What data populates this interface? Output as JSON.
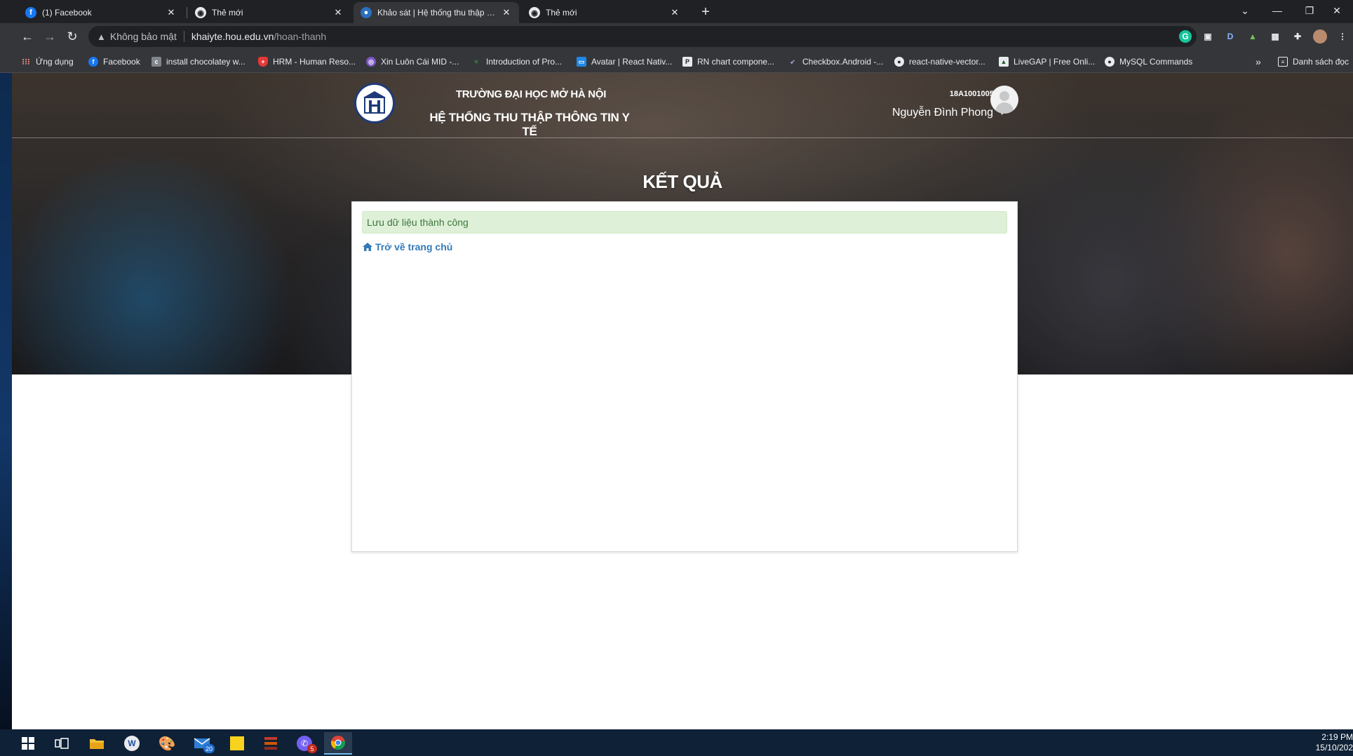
{
  "browser": {
    "tabs": [
      {
        "title": "(1) Facebook",
        "icon": "facebook-icon"
      },
      {
        "title": "Thẻ mới",
        "icon": "chrome-icon"
      },
      {
        "title": "Khảo sát | Hệ thống thu thập thô",
        "icon": "globe-icon",
        "active": true
      },
      {
        "title": "Thẻ mới",
        "icon": "chrome-icon"
      }
    ],
    "omnibox": {
      "security_text": "Không bảo mật",
      "host": "khaiyte.hou.edu.vn",
      "path": "/hoan-thanh"
    },
    "bookmarks": [
      {
        "label": "Ứng dụng",
        "icon": "apps-grid-icon"
      },
      {
        "label": "Facebook",
        "icon": "facebook-icon"
      },
      {
        "label": "install chocolatey w...",
        "icon": "chocolatey-icon"
      },
      {
        "label": "HRM - Human Reso...",
        "icon": "shield-icon"
      },
      {
        "label": "Xin Luôn Cái MID -...",
        "icon": "purple-globe-icon"
      },
      {
        "label": "Introduction of Pro...",
        "icon": "green-dash-icon"
      },
      {
        "label": "Avatar | React Nativ...",
        "icon": "react-native-icon"
      },
      {
        "label": "RN chart compone...",
        "icon": "p-square-icon"
      },
      {
        "label": "Checkbox.Android -...",
        "icon": "rocket-icon"
      },
      {
        "label": "react-native-vector...",
        "icon": "github-icon"
      },
      {
        "label": "LiveGAP | Free Onli...",
        "icon": "livegap-icon"
      },
      {
        "label": "MySQL Commands",
        "icon": "github-icon"
      }
    ],
    "bookmarks_overflow": "»",
    "reading_list": "Danh sách đọc"
  },
  "page": {
    "university": "TRƯỜNG ĐẠI HỌC MỞ HÀ NỘI",
    "system": "HỆ THỐNG THU THẬP THÔNG TIN Y TẾ",
    "student_id": "18A10010057",
    "user_name": "Nguyễn Đình Phong",
    "title": "KẾT QUẢ",
    "alert": "Lưu dữ liệu thành công",
    "home_link": "Trở về trang chủ"
  },
  "taskbar": {
    "apps": [
      {
        "name": "start-button"
      },
      {
        "name": "task-view"
      },
      {
        "name": "file-explorer"
      },
      {
        "name": "app-w"
      },
      {
        "name": "paint-app"
      },
      {
        "name": "mail-app",
        "badge": "20"
      },
      {
        "name": "sticky-notes"
      },
      {
        "name": "terminal-app"
      },
      {
        "name": "viber-app",
        "badge": "5"
      },
      {
        "name": "chrome-app",
        "active": true
      }
    ],
    "time": "2:19 PM",
    "date": "15/10/202"
  },
  "colors": {
    "chrome_dark": "#202124",
    "chrome_toolbar": "#35363a",
    "alert_bg": "#dff0d8",
    "alert_text": "#3c763d",
    "link": "#337ab7",
    "taskbar": "#0f2136"
  }
}
